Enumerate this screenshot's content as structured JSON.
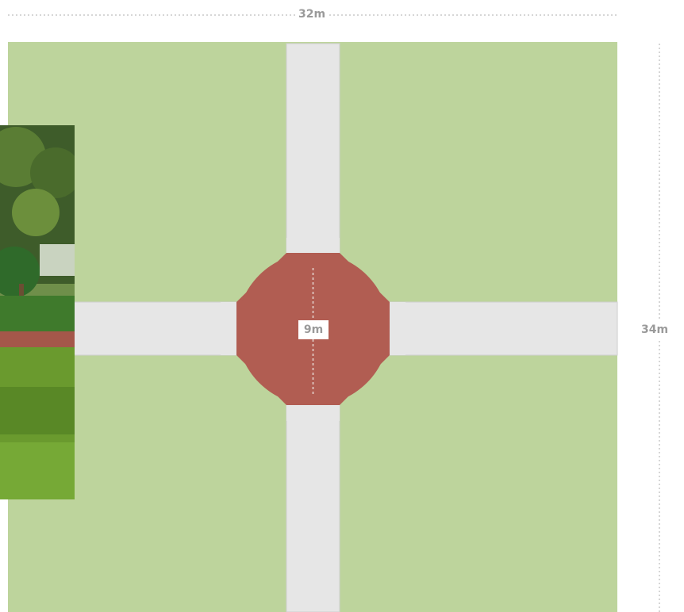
{
  "dimensions": {
    "width_label": "32m",
    "height_label": "34m",
    "center_diameter_label": "9m"
  },
  "colors": {
    "lawn": "#bdd49c",
    "path": "#e6e6e6",
    "path_edge": "#cfcfcf",
    "center_plaza": "#b15d52",
    "dimension_line": "#c8c8c8",
    "label_text": "#9a9a9a"
  },
  "photo": {
    "subject": "garden-trees-lawn-photo"
  }
}
